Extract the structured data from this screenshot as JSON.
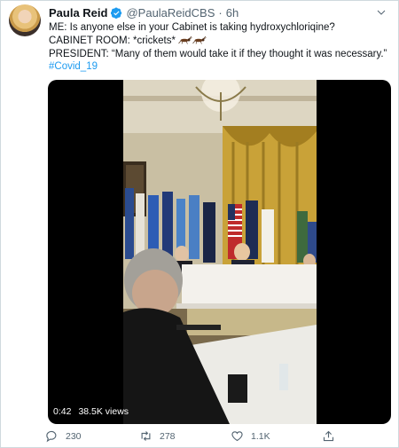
{
  "tweet": {
    "author_name": "Paula Reid",
    "handle": "@PaulaReidCBS",
    "separator": "·",
    "time": "6h",
    "lines": [
      "ME: Is anyone else in your Cabinet is taking hydroxychloriqine?",
      "CABINET ROOM: *crickets*",
      "PRESIDENT: “Many of them would take it if they thought it was necessary.”"
    ],
    "hashtag": "#Covid_19"
  },
  "video": {
    "duration": "0:42",
    "views": "38.5K views"
  },
  "actions": {
    "replies": "230",
    "retweets": "278",
    "likes": "1.1K"
  },
  "colors": {
    "accent": "#1d9bf0",
    "muted": "#536471",
    "text": "#0f1419"
  }
}
